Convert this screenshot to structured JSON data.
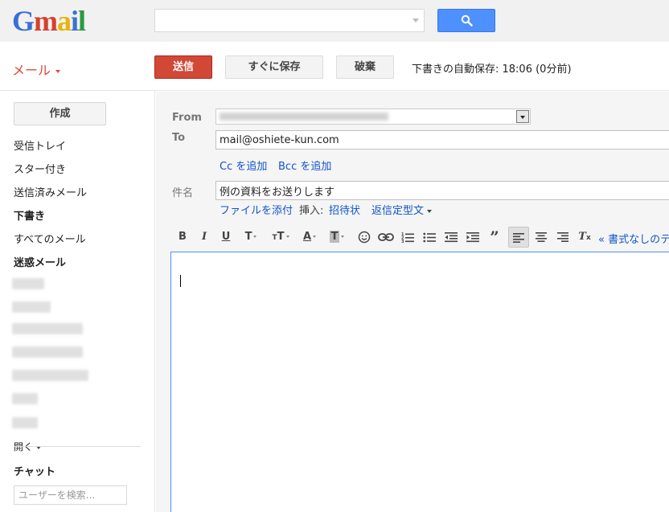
{
  "header": {
    "logo_letters": [
      {
        "char": "G",
        "color": "#3b6fd8"
      },
      {
        "char": "m",
        "color": "#d5412e"
      },
      {
        "char": "a",
        "color": "#e7b40a"
      },
      {
        "char": "i",
        "color": "#3b6fd8"
      },
      {
        "char": "l",
        "color": "#2a9a3f"
      }
    ],
    "search_value": "",
    "search_button_icon": "magnifier-icon"
  },
  "actions": {
    "mail_menu_label": "メール",
    "send_label": "送信",
    "save_now_label": "すぐに保存",
    "discard_label": "破棄",
    "autosave_text": "下書きの自動保存: 18:06 (0分前)"
  },
  "sidebar": {
    "compose_label": "作成",
    "items": [
      {
        "label": "受信トレイ",
        "bold": false
      },
      {
        "label": "スター付き",
        "bold": false
      },
      {
        "label": "送信済みメール",
        "bold": false
      },
      {
        "label": "下書き",
        "bold": true
      },
      {
        "label": "すべてのメール",
        "bold": false
      },
      {
        "label": "迷惑メール",
        "bold": true
      }
    ],
    "more_label": "開く",
    "chat_title": "チャット",
    "chat_search_placeholder": "ユーザーを検索..."
  },
  "compose": {
    "from_label": "From",
    "to_label": "To",
    "to_value": "mail@oshiete-kun.com",
    "cc_link": "Cc を追加",
    "bcc_link": "Bcc を追加",
    "subject_label": "件名",
    "subject_value": "例の資料をお送りします",
    "attach_link": "ファイルを添付",
    "insert_label": "挿入:",
    "invite_link": "招待状",
    "canned_link": "返信定型文",
    "plain_text_link": "« 書式なしのテ",
    "toolbar_icons": [
      "bold-icon",
      "italic-icon",
      "underline-icon",
      "font-icon",
      "font-size-icon",
      "text-color-icon",
      "highlight-icon",
      "emoji-icon",
      "link-icon",
      "numbered-list-icon",
      "bulleted-list-icon",
      "outdent-icon",
      "indent-icon",
      "quote-icon",
      "align-left-icon",
      "align-center-icon",
      "align-right-icon",
      "clear-format-icon"
    ]
  },
  "colors": {
    "send_button": "#d14836",
    "search_button": "#4d90fe",
    "link": "#1155cc",
    "mail_menu": "#dd4b39"
  }
}
